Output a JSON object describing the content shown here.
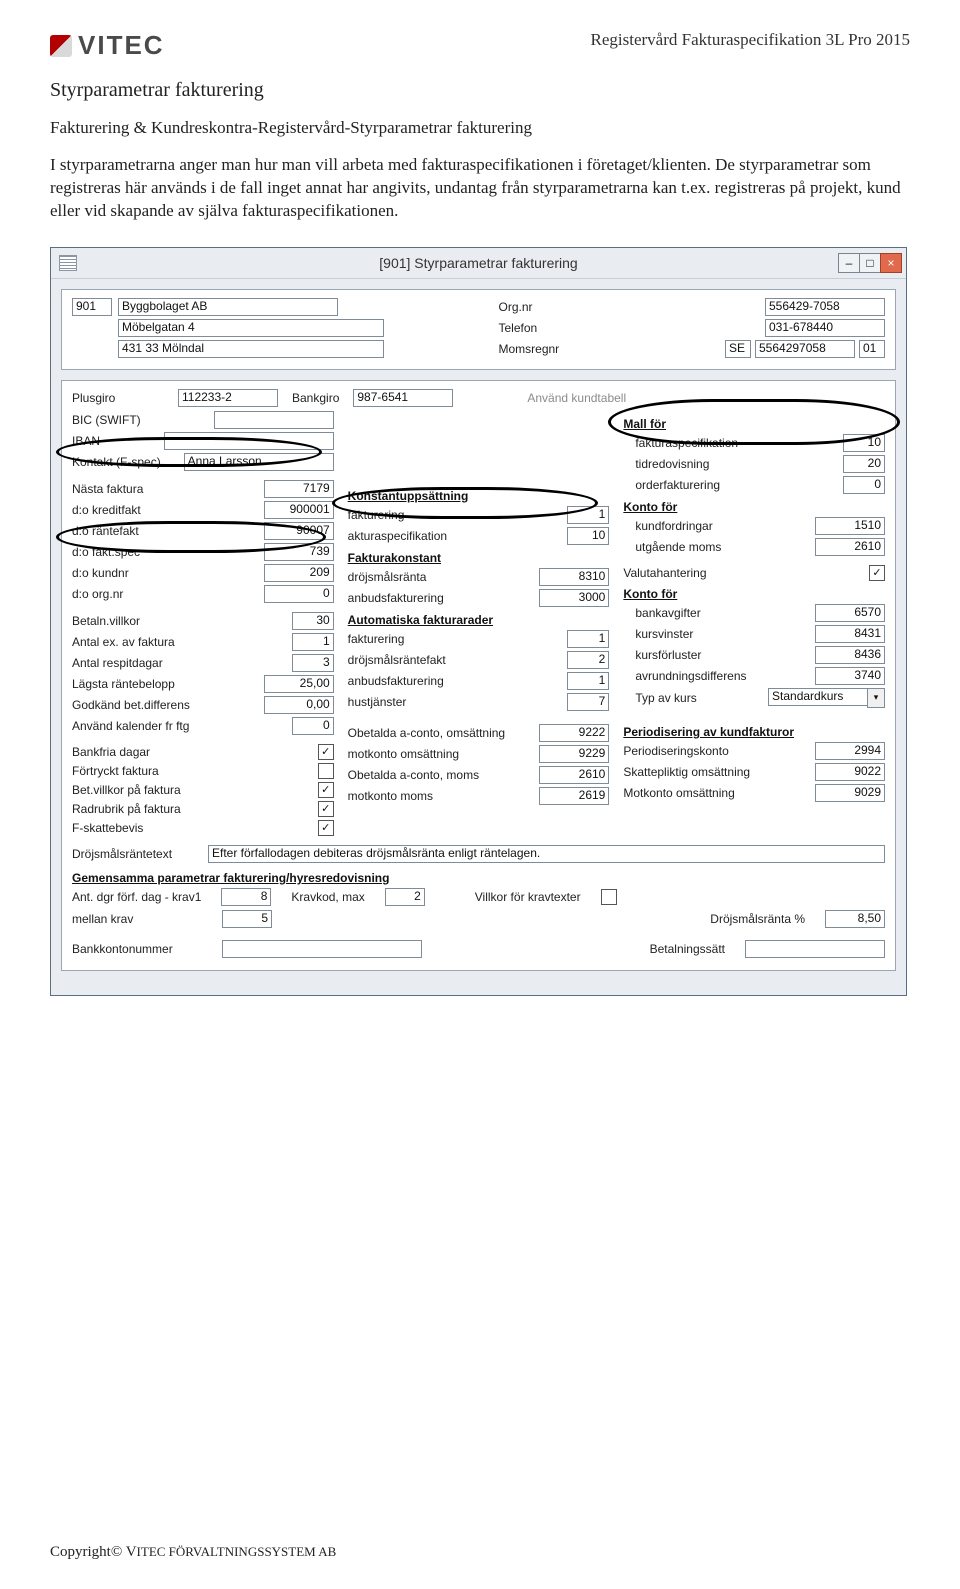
{
  "header": {
    "logo_text": "VITEC",
    "doc_title_left": "Registervård Fakturaspecifikation ",
    "doc_title_right": "3L Pro 2015"
  },
  "section_title": "Styrparametrar fakturering",
  "breadcrumb": "Fakturering & Kundreskontra-Registervård-Styrparametrar fakturering",
  "body_text": "I styrparametrarna anger man hur man vill arbeta med fakturaspecifikationen i företaget/klienten. De styrparametrar som registreras här används i de fall inget annat har angivits, undantag från styrparametrarna kan t.ex. registreras på projekt, kund eller vid skapande av själva fakturaspecifikationen.",
  "window": {
    "title": "[901]  Styrparametrar fakturering",
    "company": {
      "code": "901",
      "name": "Byggbolaget AB",
      "address1": "Möbelgatan 4",
      "address2": "431 33  Mölndal",
      "orgnr_label": "Org.nr",
      "orgnr": "556429-7058",
      "tel_label": "Telefon",
      "tel": "031-678440",
      "moms_label": "Momsregnr",
      "moms_country": "SE",
      "moms_nr": "5564297058",
      "moms_suffix": "01"
    },
    "left": {
      "plusgiro_label": "Plusgiro",
      "plusgiro": "112233-2",
      "bankgiro_label": "Bankgiro",
      "bankgiro": "987-6541",
      "bic_label": "BIC (SWIFT)",
      "bic": "",
      "iban_label": "IBAN",
      "iban": "",
      "kontakt_label": "Kontakt (F-spec)",
      "kontakt": "Anna Larsson",
      "nasta_label": "Nästa faktura",
      "nasta": "7179",
      "kredit_label": "d:o kreditfakt",
      "kredit": "900001",
      "rante_label": "d:o räntefakt",
      "rante": "90007",
      "faktspec_label": "d:o fakt.spec",
      "faktspec": "739",
      "kundnr_label": "d:o kundnr",
      "kundnr": "209",
      "orgnr_label": "d:o org.nr",
      "orgnr": "0",
      "betvillkor_label": "Betaln.villkor",
      "betvillkor": "30",
      "antalex_label": "Antal ex. av faktura",
      "antalex": "1",
      "respit_label": "Antal respitdagar",
      "respit": "3",
      "lagsta_label": "Lägsta räntebelopp",
      "lagsta": "25,00",
      "godk_label": "Godkänd bet.differens",
      "godk": "0,00",
      "anvkal_label": "Använd kalender fr ftg",
      "anvkal": "0",
      "bankfria_label": "Bankfria dagar",
      "bankfria_checked": true,
      "fortryckt_label": "Förtryckt faktura",
      "fortryckt_checked": false,
      "betvillpf_label": "Bet.villkor på faktura",
      "betvillpf_checked": true,
      "radrubrik_label": "Radrubrik på faktura",
      "radrubrik_checked": true,
      "fskatt_label": "F-skattebevis",
      "fskatt_checked": true,
      "drojtext_label": "Dröjsmålsräntetext",
      "drojtext": "Efter förfallodagen debiteras dröjsmålsränta enligt räntelagen."
    },
    "mid": {
      "anvkund_label": "Använd kundtabell",
      "konst_head": "Konstantuppsättning",
      "konst_fakt_label": "fakturering",
      "konst_fakt": "1",
      "konst_spec_label": "akturaspecifikation",
      "konst_spec": "10",
      "faktk_head": "Fakturakonstant",
      "droj_label": "dröjsmålsränta",
      "droj": "8310",
      "anbud_label": "anbudsfakturering",
      "anbud": "3000",
      "auto_head": "Automatiska fakturarader",
      "af_fakt_label": "fakturering",
      "af_fakt": "1",
      "af_droj_label": "dröjsmålsräntefakt",
      "af_droj": "2",
      "af_anbud_label": "anbudsfakturering",
      "af_anbud": "1",
      "af_hust_label": "hustjänster",
      "af_hust": "7",
      "ob_oms_label": "Obetalda a-conto, omsättning",
      "ob_oms": "9222",
      "mk_oms_label": "motkonto omsättning",
      "mk_oms": "9229",
      "ob_moms_label": "Obetalda a-conto, moms",
      "ob_moms": "2610",
      "mk_moms_label": "motkonto moms",
      "mk_moms": "2619"
    },
    "right": {
      "mall_head": "Mall för",
      "mall_spec_label": "fakturaspecifikation",
      "mall_spec": "10",
      "mall_tid_label": "tidredovisning",
      "mall_tid": "20",
      "mall_order_label": "orderfakturering",
      "mall_order": "0",
      "konto_head": "Konto för",
      "konto_kund_label": "kundfordringar",
      "konto_kund": "1510",
      "konto_moms_label": "utgående moms",
      "konto_moms": "2610",
      "valuta_label": "Valutahantering",
      "valuta_checked": true,
      "konto2_head": "Konto för",
      "bankavg_label": "bankavgifter",
      "bankavg": "6570",
      "kursv_label": "kursvinster",
      "kursv": "8431",
      "kursf_label": "kursförluster",
      "kursf": "8436",
      "avrund_label": "avrundningsdifferens",
      "avrund": "3740",
      "typ_label": "Typ av kurs",
      "typ": "Standardkurs",
      "period_head": "Periodisering av kundfakturor",
      "periodk_label": "Periodiseringskonto",
      "periodk": "2994",
      "skatt_label": "Skattepliktig omsättning",
      "skatt": "9022",
      "motk_label": "Motkonto omsättning",
      "motk": "9029"
    },
    "bottom": {
      "head": "Gemensamma parametrar fakturering/hyresredovisning",
      "ant_label": "Ant. dgr förf. dag - krav1",
      "ant": "8",
      "krav_label": "Kravkod, max",
      "krav": "2",
      "villkor_label": "Villkor för kravtexter",
      "villkor_checked": false,
      "mellan_label": "mellan krav",
      "mellan": "5",
      "drojp_label": "Dröjsmålsränta %",
      "drojp": "8,50",
      "bankk_label": "Bankkontonummer",
      "bankk": "",
      "bets_label": "Betalningssätt",
      "bets": ""
    }
  },
  "footer": {
    "prefix": "Copyright© V",
    "small": "ITEC FÖRVALTNINGSSYSTEM AB"
  }
}
